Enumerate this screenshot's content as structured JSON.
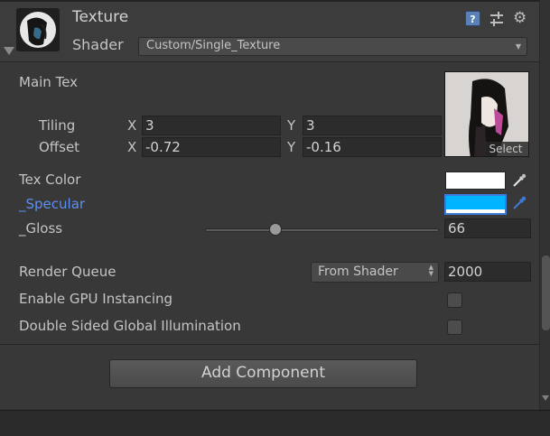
{
  "header": {
    "title": "Texture",
    "shader_label": "Shader",
    "shader_value": "Custom/Single_Texture",
    "icons": [
      "help-icon",
      "preset-icon",
      "gear-icon"
    ]
  },
  "main_tex": {
    "label": "Main Tex",
    "select_label": "Select",
    "tiling_label": "Tiling",
    "offset_label": "Offset",
    "x_axis": "X",
    "y_axis": "Y",
    "tiling_x": "3",
    "tiling_y": "3",
    "offset_x": "-0.72",
    "offset_y": "-0.16"
  },
  "properties": {
    "tex_color_label": "Tex Color",
    "tex_color": "#ffffff",
    "specular_label": "_Specular",
    "specular_color": "#00b4ff",
    "gloss_label": "_Gloss",
    "gloss_value": "66",
    "gloss_fraction": 0.3
  },
  "advanced": {
    "render_queue_label": "Render Queue",
    "render_queue_mode": "From Shader",
    "render_queue_value": "2000",
    "gpu_instancing_label": "Enable GPU Instancing",
    "gpu_instancing_checked": false,
    "double_sided_gi_label": "Double Sided Global Illumination",
    "double_sided_gi_checked": false
  },
  "add_component_label": "Add Component",
  "colors": {
    "background": "#383838",
    "label_highlight": "#5b8ff0",
    "specular": "#00b4ff"
  }
}
